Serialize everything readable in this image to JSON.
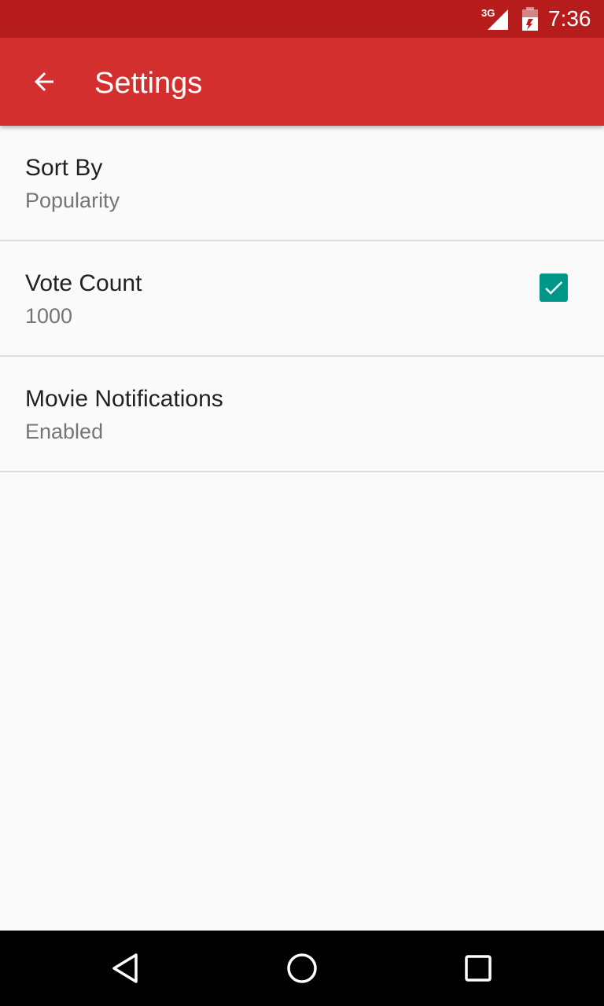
{
  "status_bar": {
    "network": "3G",
    "time": "7:36",
    "icons": [
      "signal-icon",
      "battery-icon"
    ]
  },
  "app_bar": {
    "title": "Settings",
    "back_icon": "arrow-back-icon"
  },
  "preferences": [
    {
      "title": "Sort By",
      "summary": "Popularity"
    },
    {
      "title": "Vote Count",
      "summary": "1000"
    },
    {
      "title": "Movie Notifications",
      "summary": "Enabled",
      "checked": true
    }
  ],
  "navigation_bar": {
    "icons": [
      "back-triangle-icon",
      "home-circle-icon",
      "recents-square-icon"
    ]
  },
  "colors": {
    "status_bar": "#b71c1c",
    "app_bar": "#d32f2f",
    "accent": "#009688",
    "background": "#fafafa"
  }
}
